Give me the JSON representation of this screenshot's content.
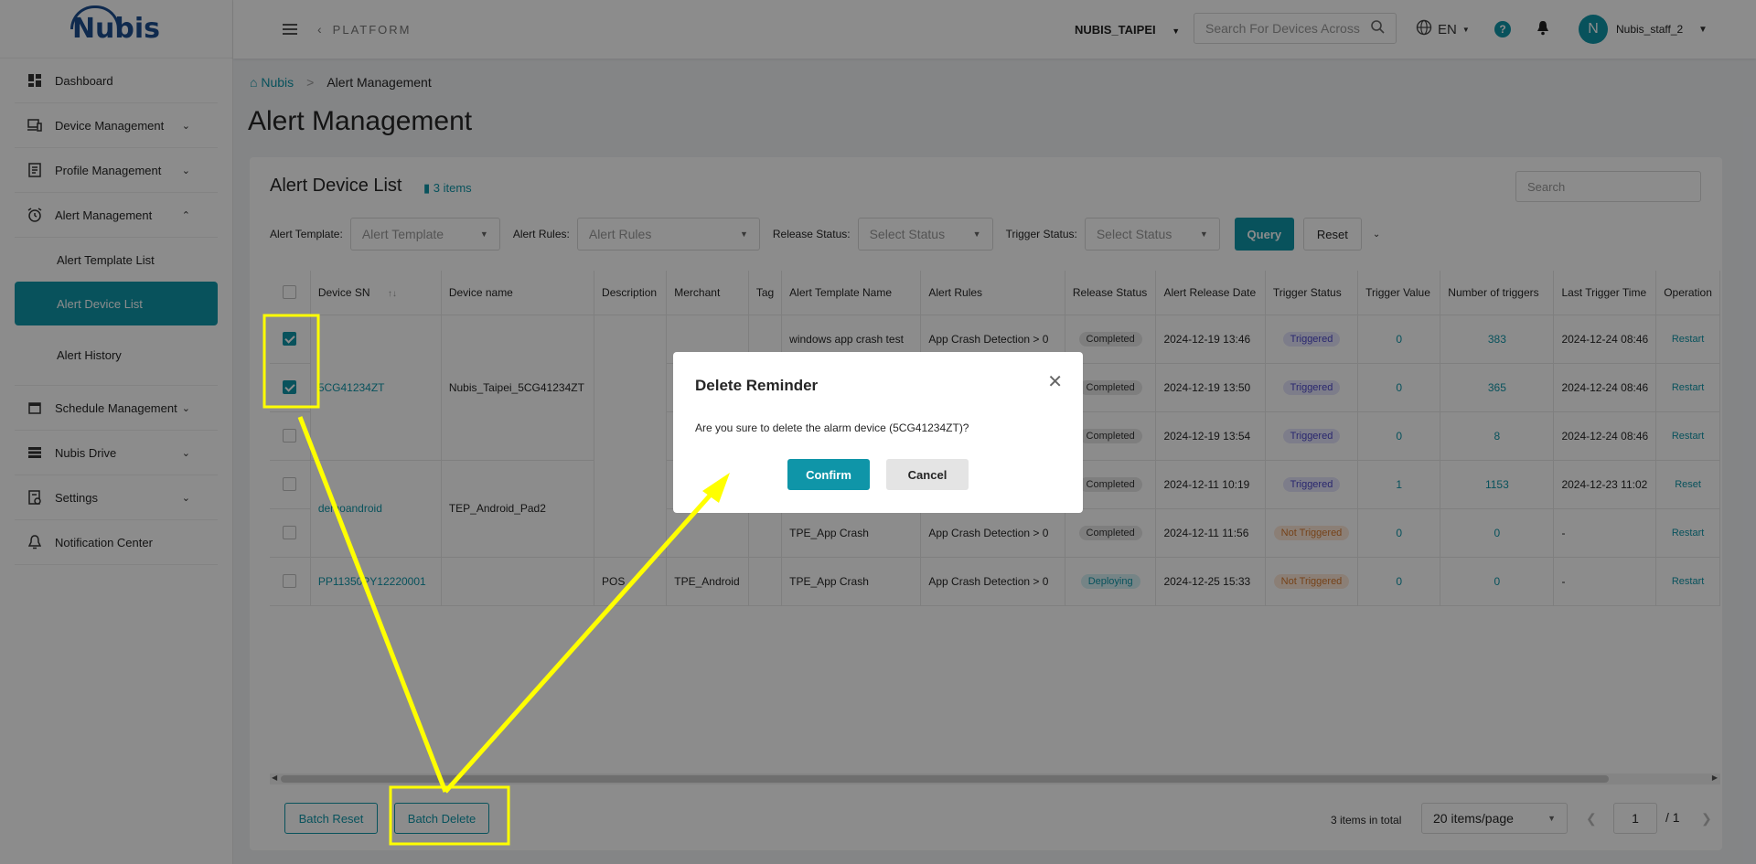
{
  "brand": {
    "logo": "Nubis",
    "accent": "#0f95a8"
  },
  "sidebar": {
    "items": [
      {
        "label": "Dashboard",
        "icon": "dashboard-icon"
      },
      {
        "label": "Device Management",
        "icon": "device-icon"
      },
      {
        "label": "Profile Management",
        "icon": "profile-icon"
      },
      {
        "label": "Alert Management",
        "icon": "alarm-clock-icon"
      },
      {
        "label": "Alert Template List"
      },
      {
        "label": "Alert Device List"
      },
      {
        "label": "Alert History"
      },
      {
        "label": "Schedule Management",
        "icon": "calendar-icon"
      },
      {
        "label": "Nubis Drive",
        "icon": "list-icon"
      },
      {
        "label": "Settings",
        "icon": "settings-icon"
      },
      {
        "label": "Notification Center",
        "icon": "bell-icon"
      }
    ]
  },
  "header": {
    "platform": "PLATFORM",
    "tenant": "NUBIS_TAIPEI",
    "search_placeholder": "Search For Devices Across",
    "language": "EN",
    "avatar_initial": "N",
    "username": "Nubis_staff_2"
  },
  "breadcrumb": {
    "home": "Nubis",
    "current": "Alert Management"
  },
  "page_title": "Alert Management",
  "list": {
    "title": "Alert Device List",
    "count": "3 items",
    "search_placeholder": "Search"
  },
  "filters": {
    "template_label": "Alert Template:",
    "template_placeholder": "Alert Template",
    "rules_label": "Alert Rules:",
    "rules_placeholder": "Alert Rules",
    "release_label": "Release Status:",
    "release_placeholder": "Select Status",
    "trigger_label": "Trigger Status:",
    "trigger_placeholder": "Select Status",
    "query": "Query",
    "reset": "Reset"
  },
  "table": {
    "headers": [
      "Device SN",
      "Device name",
      "Description",
      "Merchant",
      "Tag",
      "Alert Template Name",
      "Alert Rules",
      "Release Status",
      "Alert Release Date",
      "Trigger Status",
      "Trigger Value",
      "Number of triggers",
      "Last Trigger Time",
      "Operation"
    ],
    "group1": {
      "sn": "5CG41234ZT",
      "name": "Nubis_Taipei_5CG41234ZT"
    },
    "group2": {
      "sn": "demoandroid",
      "name": "TEP_Android_Pad2"
    },
    "rows": [
      {
        "template": "windows app crash test",
        "rule": "App Crash Detection > 0",
        "release": "Completed",
        "date": "2024-12-19 13:46",
        "trigger": "Triggered",
        "value": "0",
        "count": "383",
        "last": "2024-12-24 08:46",
        "op": "Restart"
      },
      {
        "template": "",
        "rule": "",
        "release": "Completed",
        "date": "2024-12-19 13:50",
        "trigger": "Triggered",
        "value": "0",
        "count": "365",
        "last": "2024-12-24 08:46",
        "op": "Restart"
      },
      {
        "template": "",
        "rule": "",
        "release": "Completed",
        "date": "2024-12-19 13:54",
        "trigger": "Triggered",
        "value": "0",
        "count": "8",
        "last": "2024-12-24 08:46",
        "op": "Restart"
      },
      {
        "template": "",
        "rule": "",
        "release": "Completed",
        "date": "2024-12-11 10:19",
        "trigger": "Triggered",
        "value": "1",
        "count": "1153",
        "last": "2024-12-23 11:02",
        "op": "Reset"
      },
      {
        "template": "TPE_App Crash",
        "rule": "App Crash Detection > 0",
        "release": "Completed",
        "date": "2024-12-11 11:56",
        "trigger": "Not Triggered",
        "value": "0",
        "count": "0",
        "last": "-",
        "op": "Restart"
      },
      {
        "sn": "PP11350PY12220001",
        "description": "POS",
        "merchant": "TPE_Android",
        "template": "TPE_App Crash",
        "rule": "App Crash Detection > 0",
        "release": "Deploying",
        "date": "2024-12-25 15:33",
        "trigger": "Not Triggered",
        "value": "0",
        "count": "0",
        "last": "-",
        "op": "Restart"
      }
    ]
  },
  "footer": {
    "batch_reset": "Batch Reset",
    "batch_delete": "Batch Delete",
    "total": "3 items in total",
    "page_size": "20 items/page",
    "page": "1",
    "pages": "/ 1"
  },
  "dialog": {
    "title": "Delete Reminder",
    "message": "Are you sure to delete the alarm device (5CG41234ZT)?",
    "confirm": "Confirm",
    "cancel": "Cancel"
  },
  "annotation_color": "#ffff00"
}
